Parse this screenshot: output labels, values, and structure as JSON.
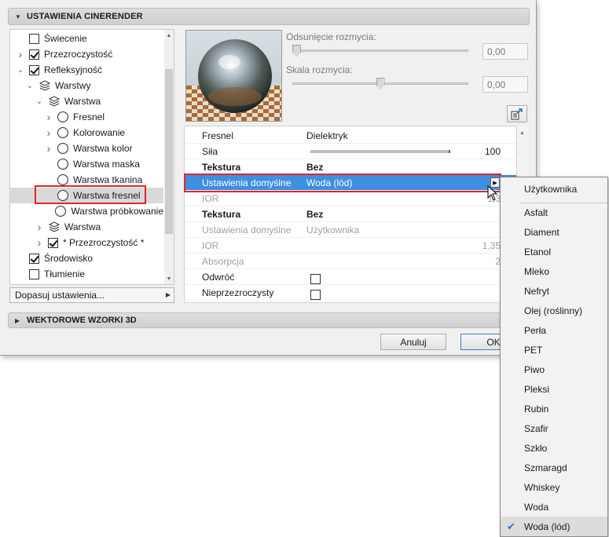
{
  "sections": {
    "cinerender_title": "USTAWIENIA CINERENDER",
    "vector_title": "WEKTOROWE WZORKI 3D"
  },
  "tree": [
    {
      "label": "Świecenie",
      "indent": 0,
      "chevron": "",
      "control": "checkbox",
      "checked": false
    },
    {
      "label": "Przezroczystość",
      "indent": 0,
      "chevron": "right",
      "control": "checkbox",
      "checked": true
    },
    {
      "label": "Refleksyjność",
      "indent": 0,
      "chevron": "down",
      "control": "checkbox",
      "checked": true
    },
    {
      "label": "Warstwy",
      "indent": 1,
      "chevron": "down",
      "control": "layers"
    },
    {
      "label": "Warstwa",
      "indent": 2,
      "chevron": "down",
      "control": "layers"
    },
    {
      "label": "Fresnel",
      "indent": 3,
      "chevron": "right",
      "control": "radio"
    },
    {
      "label": "Kolorowanie",
      "indent": 3,
      "chevron": "right",
      "control": "radio"
    },
    {
      "label": "Warstwa kolor",
      "indent": 3,
      "chevron": "right",
      "control": "radio"
    },
    {
      "label": "Warstwa maska",
      "indent": 3,
      "chevron": "",
      "control": "radio"
    },
    {
      "label": "Warstwa tkanina",
      "indent": 3,
      "chevron": "",
      "control": "radio"
    },
    {
      "label": "Warstwa fresnel",
      "indent": 3,
      "chevron": "",
      "control": "radio",
      "selected": true
    },
    {
      "label": "Warstwa próbkowanie",
      "indent": 3,
      "chevron": "",
      "control": "radio"
    },
    {
      "label": "Warstwa",
      "indent": 2,
      "chevron": "right",
      "control": "layers"
    },
    {
      "label": "* Przezroczystość *",
      "indent": 2,
      "chevron": "right",
      "control": "checkbox",
      "checked": true
    },
    {
      "label": "Środowisko",
      "indent": 0,
      "chevron": "",
      "control": "checkbox",
      "checked": true
    },
    {
      "label": "Tłumienie",
      "indent": 0,
      "chevron": "",
      "control": "checkbox",
      "checked": false
    }
  ],
  "combo_label": "Dopasuj ustawienia...",
  "sliders": {
    "blur_offset": {
      "label": "Odsunięcie rozmycia:",
      "value": "0,00",
      "position": 0
    },
    "blur_scale": {
      "label": "Skala rozmycia:",
      "value": "0,00",
      "position": 0.5
    }
  },
  "grid": {
    "fresnel": {
      "key": "Fresnel",
      "value": "Dielektryk"
    },
    "strength": {
      "key": "Siła",
      "value": "100",
      "position": 1
    },
    "texture1": {
      "key": "Tekstura",
      "value": "Bez"
    },
    "defaults1": {
      "key": "Ustawienia domyślne",
      "value": "Woda (lód)"
    },
    "ior1": {
      "key": "IOR",
      "value": "1,3"
    },
    "texture2": {
      "key": "Tekstura",
      "value": "Bez"
    },
    "defaults2": {
      "key": "Ustawienia domyślne",
      "value": "Użytkownika"
    },
    "ior2": {
      "key": "IOR",
      "value": "1,35"
    },
    "absorption": {
      "key": "Absorpcja",
      "value": "2"
    },
    "invert": {
      "key": "Odwróć"
    },
    "opaque": {
      "key": "Nieprzezroczysty"
    }
  },
  "buttons": {
    "cancel": "Anuluj",
    "ok": "OK"
  },
  "menu": {
    "header": "Użytkownika",
    "items": [
      "Asfalt",
      "Diament",
      "Etanol",
      "Mleko",
      "Nefryt",
      "Olej (roślinny)",
      "Perła",
      "PET",
      "Piwo",
      "Pleksi",
      "Rubin",
      "Szafir",
      "Szkło",
      "Szmaragd",
      "Whiskey",
      "Woda",
      "Woda (lód)"
    ],
    "checked_item": "Woda (lód)"
  },
  "colors": {
    "selection": "#3d8fe0",
    "highlight_outline": "#e3252a",
    "checkmark": "#2c6fd0"
  }
}
